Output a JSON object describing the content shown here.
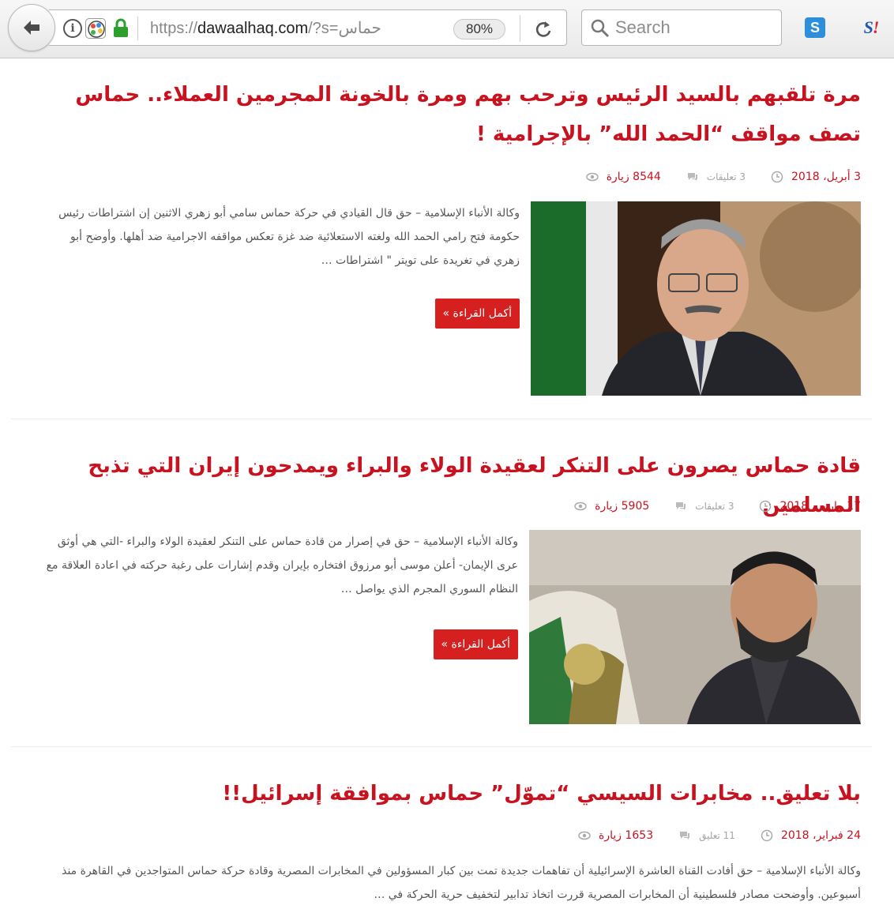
{
  "browser": {
    "url_scheme": "https://",
    "url_host": "dawaalhaq.com",
    "url_path": "/?s=حماس",
    "zoom": "80%",
    "search_placeholder": "Search",
    "ext_s_label": "S",
    "ext_sj_label": "S",
    "ext_sj_bang": "!"
  },
  "articles": [
    {
      "title": "مرة تلقبهم بالسيد الرئيس وترحب بهم ومرة بالخونة المجرمين العملاء.. حماس تصف مواقف “الحمد الله” بالإجرامية !",
      "date": "3 أبريل، 2018",
      "comments": "3 تعليقات",
      "views": "8544 زيارة",
      "excerpt": "وكالة الأنباء الإسلامية – حق قال القيادي في حركة حماس سامي أبو زهري الاثنين إن اشتراطات رئيس حكومة فتح رامي الحمد الله ولغته الاستعلائية ضد غزة تعكس مواقفه الاجرامية ضد أهلها. وأوضح أبو زهري في تغريدة على تويتر \" اشتراطات …",
      "read_more": "أكمل القراءة »"
    },
    {
      "title": "قادة حماس يصرون على التنكر لعقيدة الولاء والبراء ويمدحون إيران التي تذبح المسلمين",
      "date": "17 مارس، 2018",
      "comments": "3 تعليقات",
      "views": "5905 زيارة",
      "excerpt": "وكالة الأنباء الإسلامية – حق في إصرار من قادة حماس على التنكر لعقيدة الولاء والبراء -التي هي أوثق عرى الإيمان- أعلن موسى أبو مرزوق افتخاره بإيران وقدم إشارات على رغبة حركته في اعادة العلاقة مع النظام السوري المجرم الذي يواصل …",
      "read_more": "أكمل القراءة »"
    },
    {
      "title": "بلا تعليق.. مخابرات السيسي “تموّل” حماس بموافقة إسرائيل!!",
      "date": "24 فبراير، 2018",
      "comments": "11 تعليق",
      "views": "1653 زيارة",
      "excerpt": "وكالة الأنباء الإسلامية – حق أفادت القناة العاشرة الإسرائيلية أن تفاهمات جديدة تمت بين كبار المسؤولين في المخابرات المصرية وقادة حركة حماس المتواجدين في القاهرة منذ أسبوعين. وأوضحت مصادر فلسطينية أن المخابرات المصرية قررت اتخاذ تدابير لتخفيف حرية الحركة في …"
    }
  ],
  "colors": {
    "accent": "#c8121f",
    "button": "#d5201f"
  }
}
